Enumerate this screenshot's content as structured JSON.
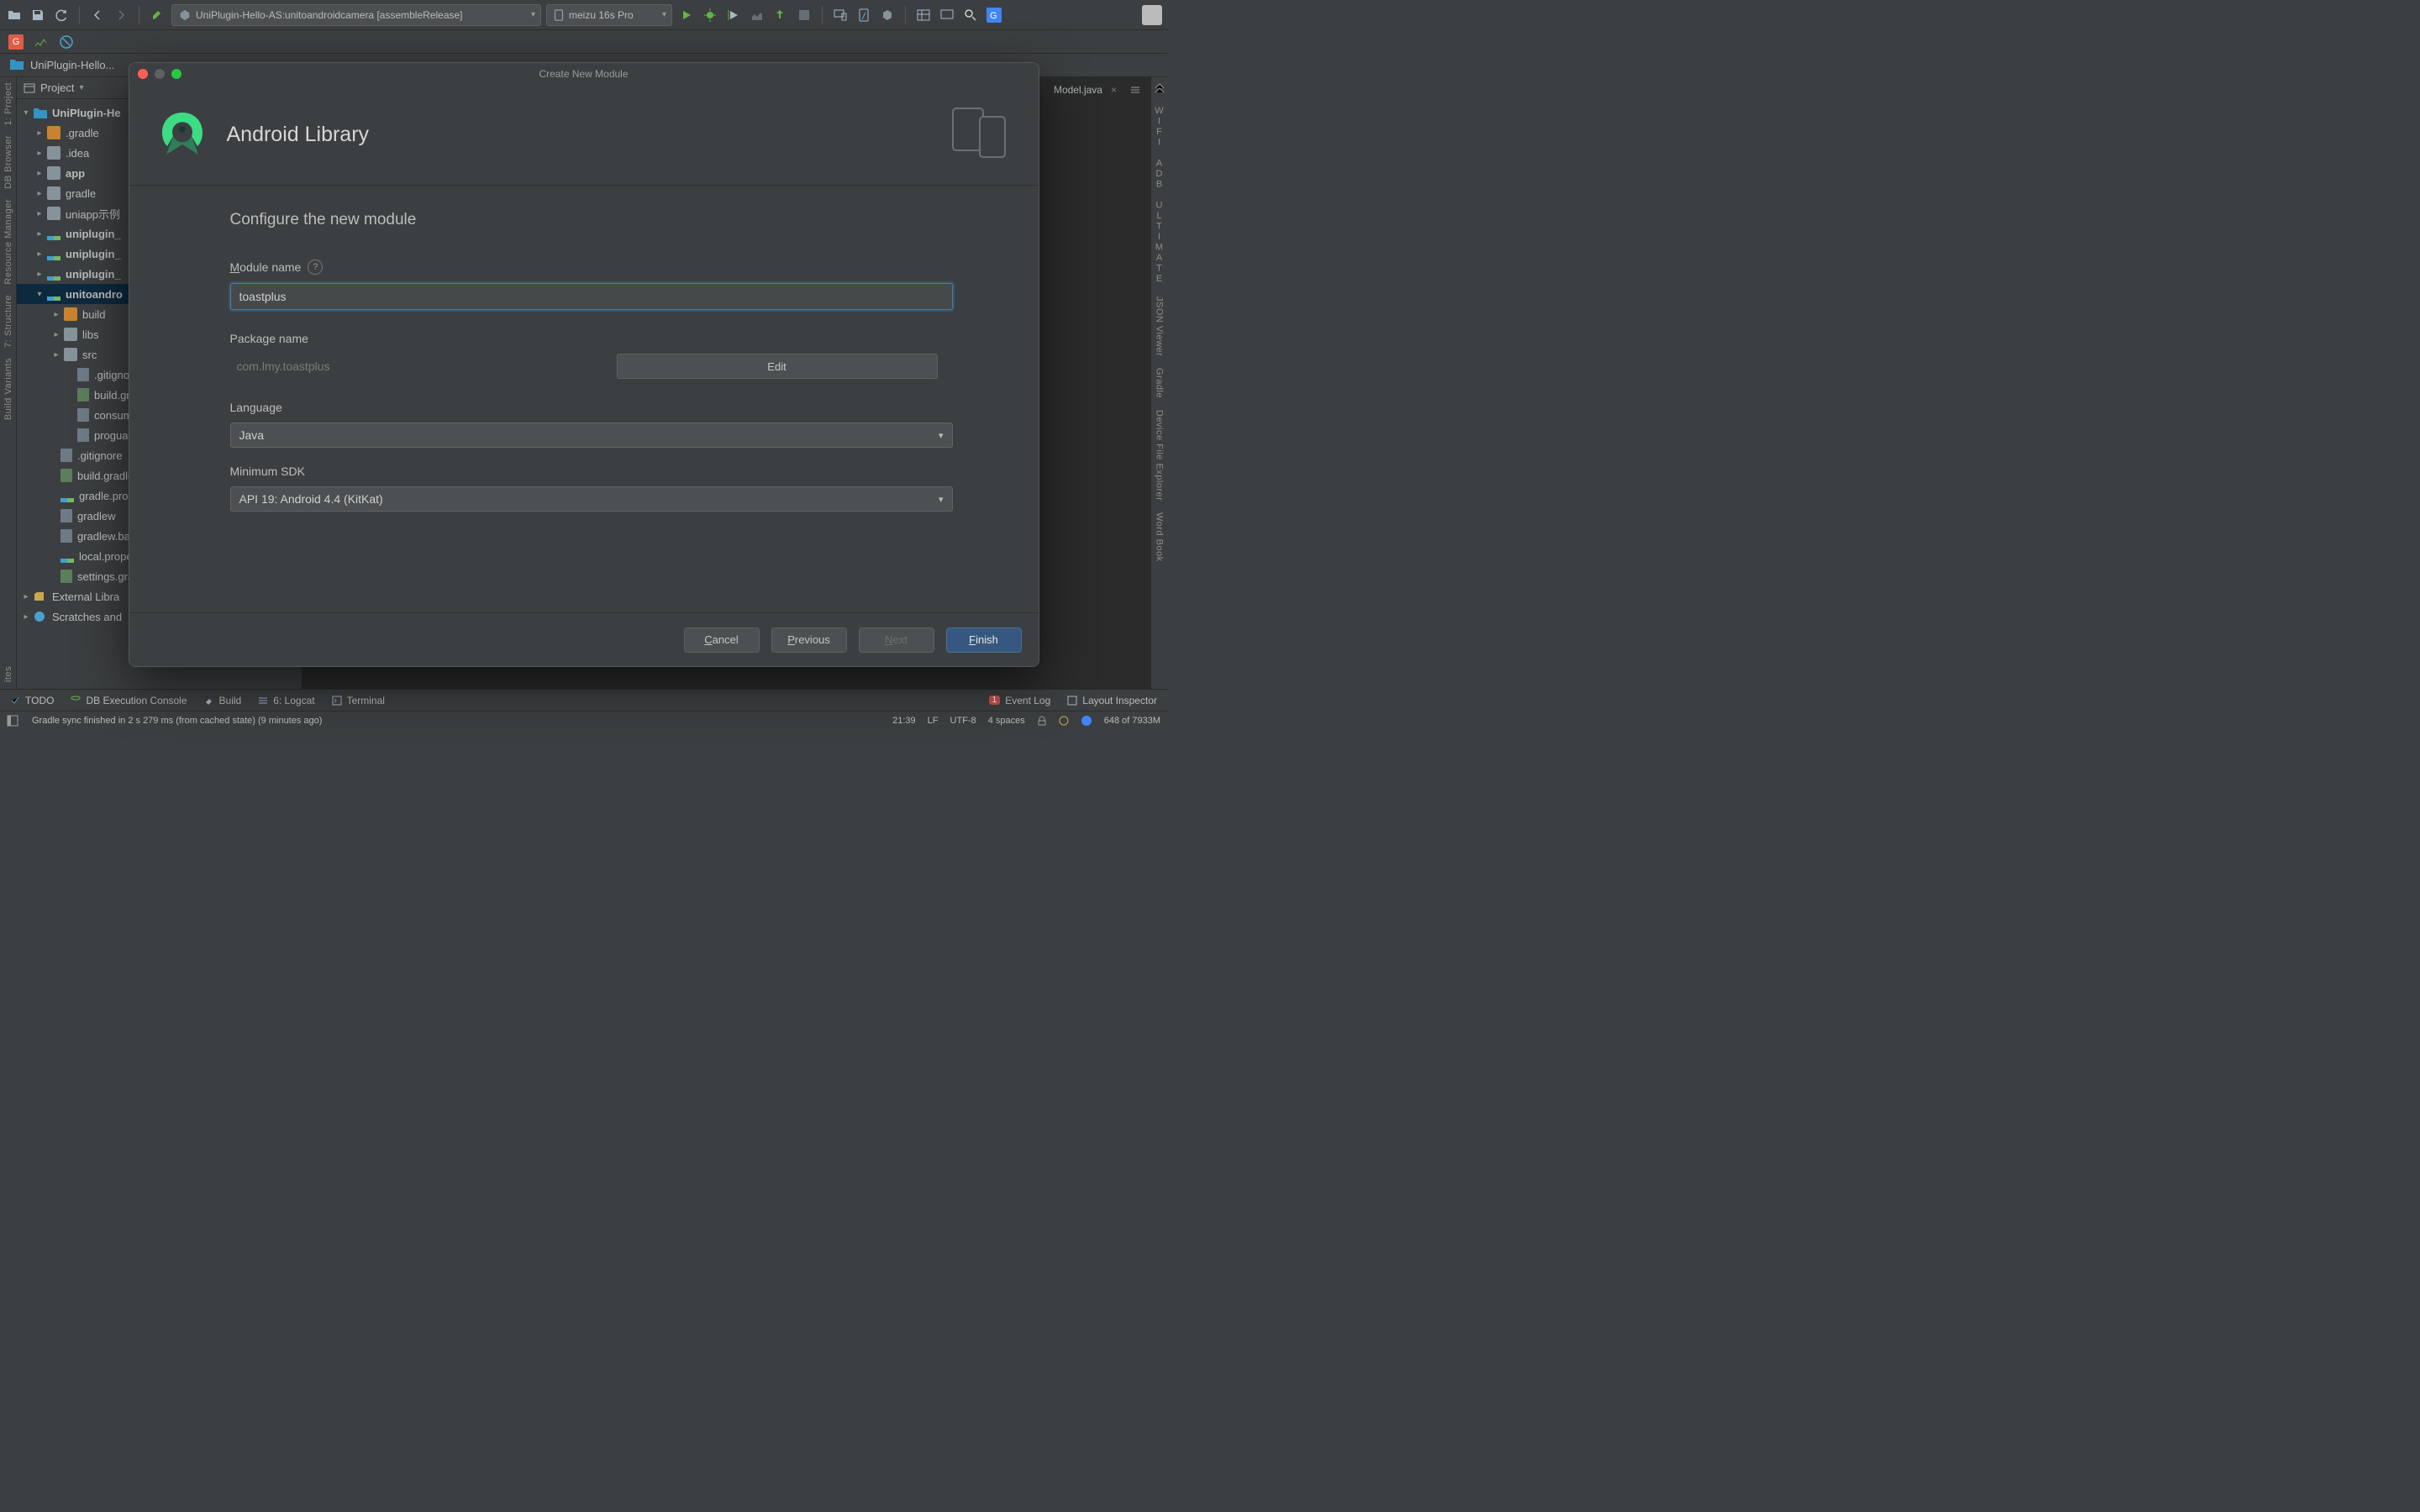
{
  "toolbar": {
    "run_config": "UniPlugin-Hello-AS:unitoandroidcamera [assembleRelease]",
    "device": "meizu 16s Pro"
  },
  "breadcrumb": {
    "project": "UniPlugin-Hello..."
  },
  "projectPanel": {
    "title": "Project"
  },
  "tree": {
    "root": "UniPlugin-He",
    "items": [
      ".gradle",
      ".idea",
      "app",
      "gradle",
      "uniapp示例",
      "uniplugin_",
      "uniplugin_",
      "uniplugin_",
      "unitoandro",
      "build",
      "libs",
      "src",
      ".gitignore",
      "build.gra",
      "consume",
      "proguard",
      ".gitignore",
      "build.gradle",
      "gradle.prop",
      "gradlew",
      "gradlew.bat",
      "local.prope",
      "settings.gra"
    ],
    "external": "External Libra",
    "scratches": "Scratches and"
  },
  "editorTab": "Model.java",
  "bottom": {
    "todo": "TODO",
    "db": "DB Execution Console",
    "build": "Build",
    "logcat": "6: Logcat",
    "terminal": "Terminal",
    "eventlog": "Event Log",
    "layout": "Layout Inspector"
  },
  "status": {
    "msg": "Gradle sync finished in 2 s 279 ms (from cached state) (9 minutes ago)",
    "pos": "21:39",
    "le": "LF",
    "enc": "UTF-8",
    "indent": "4 spaces",
    "mem": "648 of 7933M"
  },
  "rightbar": {
    "wifi": "WIFI ADB ULTIMATE",
    "json": "JSON Viewer",
    "gradle": "Gradle",
    "device": "Device File Explorer",
    "word": "Word Book"
  },
  "leftbar": {
    "project": "1: Project",
    "db": "DB Browser",
    "res": "Resource Manager",
    "struct": "7: Structure",
    "build": "Build Variants",
    "fav": "ites"
  },
  "modal": {
    "title": "Create New Module",
    "header": "Android Library",
    "subtitle": "Configure the new module",
    "moduleName": {
      "label": "Module name",
      "value": "toastplus"
    },
    "packageName": {
      "label": "Package name",
      "value": "com.lmy.toastplus",
      "editBtn": "Edit"
    },
    "language": {
      "label": "Language",
      "value": "Java"
    },
    "minsdk": {
      "label": "Minimum SDK",
      "value": "API 19: Android 4.4 (KitKat)"
    },
    "buttons": {
      "cancel": "Cancel",
      "prev": "Previous",
      "next": "Next",
      "finish": "Finish"
    }
  }
}
